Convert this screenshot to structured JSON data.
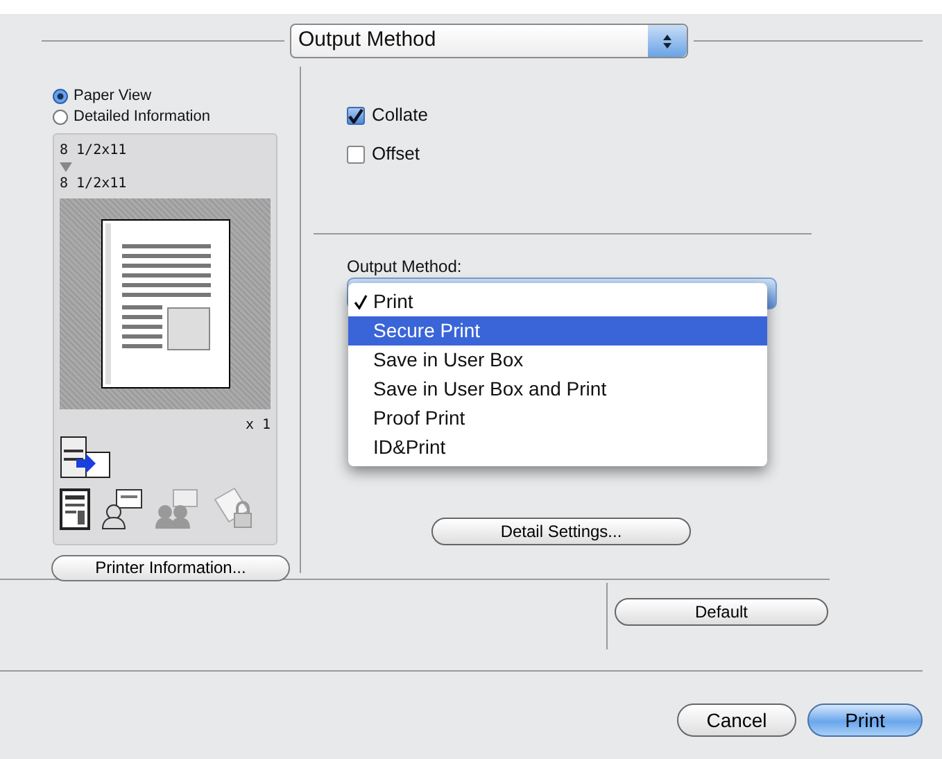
{
  "section_popup": {
    "label": "Output Method"
  },
  "view_options": [
    {
      "label": "Paper View",
      "selected": true
    },
    {
      "label": "Detailed Information",
      "selected": false
    }
  ],
  "preview": {
    "original_size": "8 1/2x11",
    "output_size": "8 1/2x11",
    "copies": "x 1"
  },
  "printer_info_button": "Printer Information...",
  "options": [
    {
      "label": "Collate",
      "checked": true
    },
    {
      "label": "Offset",
      "checked": false
    }
  ],
  "output_method": {
    "label": "Output Method:",
    "menu": [
      {
        "label": "Print",
        "checked": true,
        "selected": false
      },
      {
        "label": "Secure Print",
        "checked": false,
        "selected": true
      },
      {
        "label": "Save in User Box",
        "checked": false,
        "selected": false
      },
      {
        "label": "Save in User Box and Print",
        "checked": false,
        "selected": false
      },
      {
        "label": "Proof Print",
        "checked": false,
        "selected": false
      },
      {
        "label": "ID&Print",
        "checked": false,
        "selected": false
      }
    ]
  },
  "detail_button": "Detail Settings...",
  "default_button": "Default",
  "buttons": [
    {
      "label": "Cancel",
      "default": false
    },
    {
      "label": "Print",
      "default": true
    }
  ]
}
